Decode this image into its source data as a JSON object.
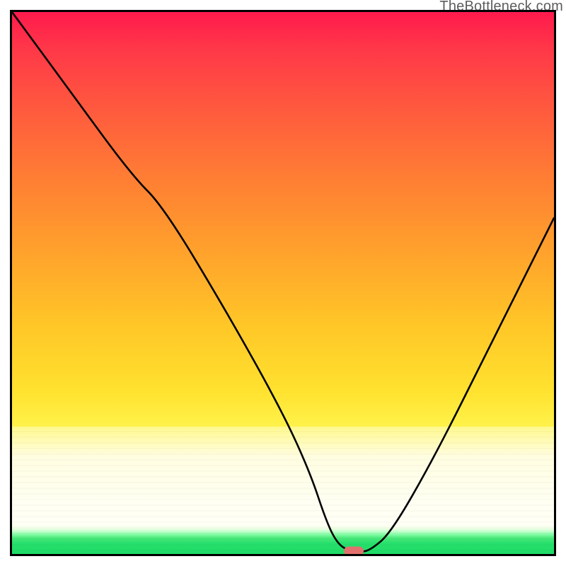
{
  "watermark": "TheBottleneck.com",
  "chart_data": {
    "type": "line",
    "title": "",
    "xlabel": "",
    "ylabel": "",
    "xlim": [
      0,
      100
    ],
    "ylim": [
      0,
      100
    ],
    "x": [
      0,
      11,
      22,
      28,
      40,
      50,
      55,
      58,
      60,
      62,
      64,
      66,
      70,
      78,
      88,
      98,
      100
    ],
    "values": [
      100,
      85,
      70,
      64,
      44,
      26,
      15,
      6,
      2,
      0.6,
      0.4,
      0.6,
      4,
      18,
      38,
      58,
      62
    ],
    "annotations": [
      {
        "name": "optimal-marker",
        "x": 63,
        "y": 0.5,
        "color": "#e2716d"
      }
    ],
    "background": {
      "type": "vertical_gradient",
      "stops": [
        {
          "pos": 0.0,
          "color": "#ff1a4d"
        },
        {
          "pos": 0.3,
          "color": "#ff7c34"
        },
        {
          "pos": 0.58,
          "color": "#ffc727"
        },
        {
          "pos": 0.765,
          "color": "#fff24a"
        },
        {
          "pos": 0.9,
          "color": "#fffff2"
        },
        {
          "pos": 0.96,
          "color": "#8effae"
        },
        {
          "pos": 1.0,
          "color": "#1edc67"
        }
      ]
    }
  }
}
